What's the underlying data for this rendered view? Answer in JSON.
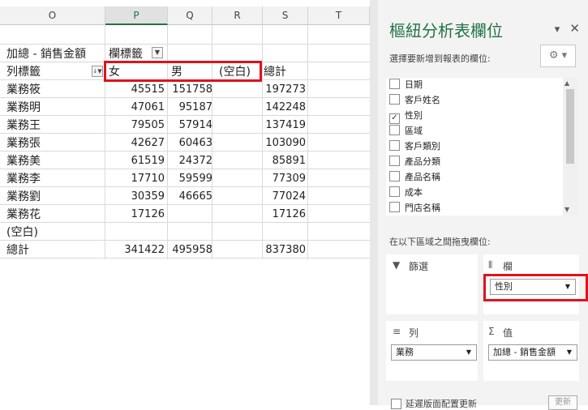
{
  "sheet": {
    "columns": [
      "O",
      "P",
      "Q",
      "R",
      "S",
      "T"
    ],
    "values_label": "加總 - 銷售金額",
    "col_label_header": "欄標籤",
    "row_label_header": "列標籤",
    "col_headers": [
      "女",
      "男",
      "(空白)",
      "總計"
    ],
    "rows": [
      {
        "label": "業務筱",
        "f": "45515",
        "m": "151758",
        "total": "197273"
      },
      {
        "label": "業務明",
        "f": "47061",
        "m": "95187",
        "total": "142248"
      },
      {
        "label": "業務王",
        "f": "79505",
        "m": "57914",
        "total": "137419"
      },
      {
        "label": "業務張",
        "f": "42627",
        "m": "60463",
        "total": "103090"
      },
      {
        "label": "業務美",
        "f": "61519",
        "m": "24372",
        "total": "85891"
      },
      {
        "label": "業務李",
        "f": "17710",
        "m": "59599",
        "total": "77309"
      },
      {
        "label": "業務劉",
        "f": "30359",
        "m": "46665",
        "total": "77024"
      },
      {
        "label": "業務花",
        "f": "17126",
        "m": "",
        "total": "17126"
      },
      {
        "label": "(空白)",
        "f": "",
        "m": "",
        "total": ""
      }
    ],
    "grand_total": {
      "label": "總計",
      "f": "341422",
      "m": "495958",
      "total": "837380"
    },
    "highlight_color": "#e0121b"
  },
  "panel": {
    "title": "樞紐分析表欄位",
    "choose_hint": "選擇要新增到報表的欄位:",
    "fields": [
      {
        "name": "日期",
        "checked": false
      },
      {
        "name": "客戶姓名",
        "checked": false
      },
      {
        "name": "性別",
        "checked": true
      },
      {
        "name": "區域",
        "checked": false
      },
      {
        "name": "客戶類別",
        "checked": false
      },
      {
        "name": "產品分類",
        "checked": false
      },
      {
        "name": "產品名稱",
        "checked": false
      },
      {
        "name": "成本",
        "checked": false
      },
      {
        "name": "門店名稱",
        "checked": false
      }
    ],
    "drag_hint": "在以下區域之間拖曳欄位:",
    "zones": {
      "filter": "篩選",
      "columns": "欄",
      "rows": "列",
      "values": "值"
    },
    "columns_field": "性別",
    "rows_field": "業務",
    "values_field": "加總 - 銷售金額",
    "defer_label": "延遲版面配置更新",
    "update_label": "更新",
    "accent_color": "#217346"
  }
}
